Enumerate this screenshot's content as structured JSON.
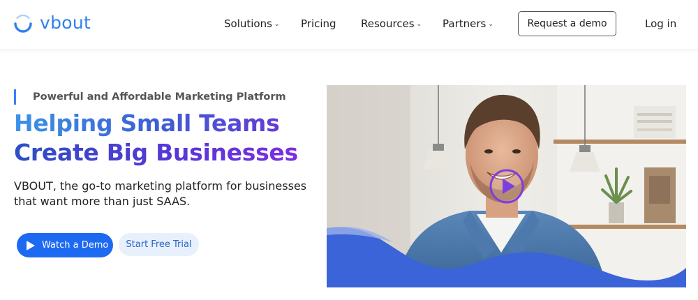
{
  "brand": {
    "name": "vbout",
    "color": "#2f80ed"
  },
  "nav": {
    "items": [
      {
        "label": "Solutions",
        "dropdown": true
      },
      {
        "label": "Pricing",
        "dropdown": false
      },
      {
        "label": "Resources",
        "dropdown": true
      },
      {
        "label": "Partners",
        "dropdown": true
      }
    ],
    "demo_button": "Request a demo",
    "login": "Log in"
  },
  "hero": {
    "eyebrow": "Powerful and Affordable Marketing Platform",
    "headline_line1": "Helping Small Teams",
    "headline_line2": "Create Big Businesses",
    "subtext": "VBOUT, the go-to marketing platform for businesses that want more than just SAAS.",
    "primary_button": "Watch a Demo",
    "secondary_button": "Start Free Trial"
  },
  "colors": {
    "accent": "#1d6af2",
    "secondary_bg": "#e8f0fc",
    "wave": "#3a64d8"
  },
  "icons": {
    "logo": "vbout-logo-icon",
    "chevron": "chevron-down-icon",
    "play": "play-icon",
    "video_play": "video-play-icon"
  }
}
